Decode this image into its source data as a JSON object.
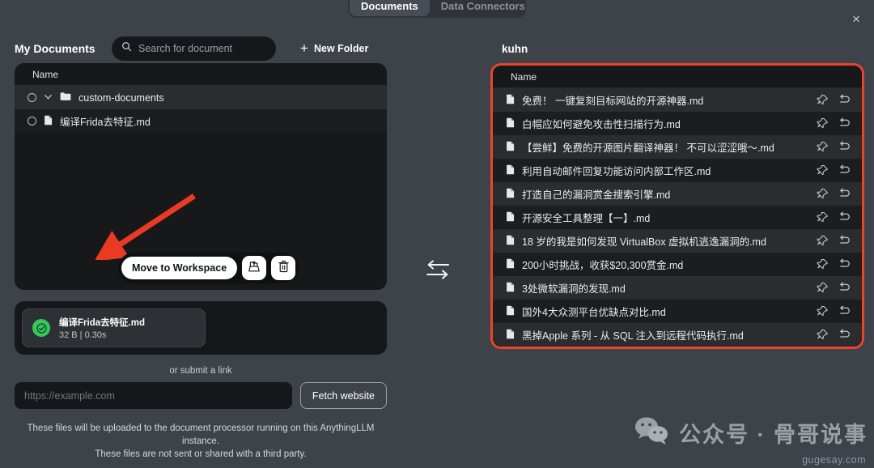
{
  "tabs": [
    {
      "label": "Documents",
      "active": true
    },
    {
      "label": "Data Connectors",
      "active": false
    }
  ],
  "close_label": "×",
  "left": {
    "title": "My Documents",
    "search": {
      "placeholder": "Search for document",
      "value": ""
    },
    "new_folder_label": "New Folder",
    "column_header": "Name",
    "rows": [
      {
        "name": "custom-documents",
        "type": "folder"
      },
      {
        "name": "编译Frida去特征.md",
        "type": "file"
      }
    ],
    "move_to_workspace_label": "Move to Workspace",
    "upload": {
      "filename": "编译Frida去特征.md",
      "meta": "32 B | 0.30s"
    },
    "or_submit_link": "or submit a link",
    "url_placeholder": "https://example.com",
    "url_value": "",
    "fetch_label": "Fetch website",
    "disclaimer_line1": "These files will be uploaded to the document processor running on this AnythingLLM instance.",
    "disclaimer_line2": "These files are not sent or shared with a third party."
  },
  "right": {
    "workspace_name": "kuhn",
    "column_header": "Name",
    "rows": [
      {
        "name": "免费！ 一键复刻目标网站的开源神器.md"
      },
      {
        "name": "白帽应如何避免攻击性扫描行为.md"
      },
      {
        "name": "【尝鲜】免费的开源图片翻译神器！ 不可以涩涩哦～.md"
      },
      {
        "name": "利用自动邮件回复功能访问内部工作区.md"
      },
      {
        "name": "打造自己的漏洞赏金搜索引擎.md"
      },
      {
        "name": "开源安全工具整理【一】.md"
      },
      {
        "name": "18 岁的我是如何发现 VirtualBox 虚拟机逃逸漏洞的.md"
      },
      {
        "name": "200小时挑战，收获$20,300赏金.md"
      },
      {
        "name": "3处微软漏洞的发现.md"
      },
      {
        "name": "国外4大众测平台优缺点对比.md"
      },
      {
        "name": "黑掉Apple 系列 - 从 SQL 注入到远程代码执行.md"
      }
    ]
  },
  "watermark": {
    "text": "公众号 · 骨哥说事",
    "url": "gugesay.com"
  },
  "colors": {
    "page_bg": "#3e4349",
    "panel_bg": "#16181a",
    "row_odd": "#2b2c2d",
    "row_even": "#1b1d1f",
    "accent_red": "#e8452c",
    "success_green": "#37c65d"
  }
}
